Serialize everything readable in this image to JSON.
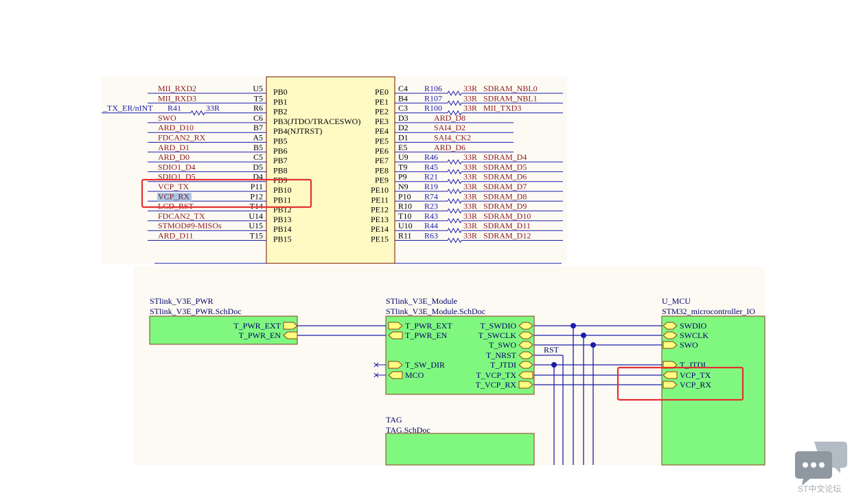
{
  "top_schematic": {
    "chip_left_pins": [
      {
        "net": "MII_RXD2",
        "ball": "U5",
        "pin": "PB0",
        "resistor": "",
        "value": ""
      },
      {
        "net": "MII_RXD3",
        "ball": "T5",
        "pin": "PB1",
        "resistor": "",
        "value": ""
      },
      {
        "net": "_TX_ER/nINT",
        "ball": "R6",
        "pin": "PB2",
        "resistor": "R41",
        "value": "33R"
      },
      {
        "net": "SWO",
        "ball": "C6",
        "pin": "PB3(JTDO/TRACESWO)",
        "resistor": "",
        "value": ""
      },
      {
        "net": "ARD_D10",
        "ball": "B7",
        "pin": "PB4(NJTRST)",
        "resistor": "",
        "value": ""
      },
      {
        "net": "FDCAN2_RX",
        "ball": "A5",
        "pin": "PB5",
        "resistor": "",
        "value": ""
      },
      {
        "net": "ARD_D1",
        "ball": "B5",
        "pin": "PB6",
        "resistor": "",
        "value": ""
      },
      {
        "net": "ARD_D0",
        "ball": "C5",
        "pin": "PB7",
        "resistor": "",
        "value": ""
      },
      {
        "net": "SDIO1_D4",
        "ball": "D5",
        "pin": "PB8",
        "resistor": "",
        "value": ""
      },
      {
        "net": "SDIO1_D5",
        "ball": "D4",
        "pin": "PB9",
        "resistor": "",
        "value": ""
      },
      {
        "net": "VCP_TX",
        "ball": "P11",
        "pin": "PB10",
        "resistor": "",
        "value": ""
      },
      {
        "net": "VCP_RX",
        "ball": "P12",
        "pin": "PB11",
        "resistor": "",
        "value": ""
      },
      {
        "net": "LCD_RST",
        "ball": "T14",
        "pin": "PB12",
        "resistor": "",
        "value": ""
      },
      {
        "net": "FDCAN2_TX",
        "ball": "U14",
        "pin": "PB13",
        "resistor": "",
        "value": ""
      },
      {
        "net": "STMOD#9-MISOs",
        "ball": "U15",
        "pin": "PB14",
        "resistor": "",
        "value": ""
      },
      {
        "net": "ARD_D11",
        "ball": "T15",
        "pin": "PB15",
        "resistor": "",
        "value": ""
      }
    ],
    "chip_right_pins": [
      {
        "pin": "PE0",
        "ball": "C4",
        "resistor": "R106",
        "value": "33R",
        "net": "SDRAM_NBL0"
      },
      {
        "pin": "PE1",
        "ball": "B4",
        "resistor": "R107",
        "value": "33R",
        "net": "SDRAM_NBL1"
      },
      {
        "pin": "PE2",
        "ball": "C3",
        "resistor": "R100",
        "value": "33R",
        "net": "MII_TXD3"
      },
      {
        "pin": "PE3",
        "ball": "D3",
        "resistor": "",
        "value": "",
        "net": "ARD_D8"
      },
      {
        "pin": "PE4",
        "ball": "D2",
        "resistor": "",
        "value": "",
        "net": "SAI4_D2"
      },
      {
        "pin": "PE5",
        "ball": "D1",
        "resistor": "",
        "value": "",
        "net": "SAI4_CK2"
      },
      {
        "pin": "PE6",
        "ball": "E5",
        "resistor": "",
        "value": "",
        "net": "ARD_D6"
      },
      {
        "pin": "PE7",
        "ball": "U9",
        "resistor": "R46",
        "value": "33R",
        "net": "SDRAM_D4"
      },
      {
        "pin": "PE8",
        "ball": "T9",
        "resistor": "R45",
        "value": "33R",
        "net": "SDRAM_D5"
      },
      {
        "pin": "PE9",
        "ball": "P9",
        "resistor": "R21",
        "value": "33R",
        "net": "SDRAM_D6"
      },
      {
        "pin": "PE10",
        "ball": "N9",
        "resistor": "R19",
        "value": "33R",
        "net": "SDRAM_D7"
      },
      {
        "pin": "PE11",
        "ball": "P10",
        "resistor": "R74",
        "value": "33R",
        "net": "SDRAM_D8"
      },
      {
        "pin": "PE12",
        "ball": "R10",
        "resistor": "R23",
        "value": "33R",
        "net": "SDRAM_D9"
      },
      {
        "pin": "PE13",
        "ball": "T10",
        "resistor": "R43",
        "value": "33R",
        "net": "SDRAM_D10"
      },
      {
        "pin": "PE14",
        "ball": "U10",
        "resistor": "R44",
        "value": "33R",
        "net": "SDRAM_D11"
      },
      {
        "pin": "PE15",
        "ball": "R11",
        "resistor": "R63",
        "value": "33R",
        "net": "SDRAM_D12"
      }
    ]
  },
  "bottom_schematic": {
    "pwr_sheet": {
      "name": "STlink_V3E_PWR",
      "file": "STlink_V3E_PWR.SchDoc",
      "ports": [
        "T_PWR_EXT",
        "T_PWR_EN"
      ]
    },
    "module_sheet": {
      "name": "STlink_V3E_Module",
      "file": "STlink_V3E_Module.SchDoc",
      "left_ports": [
        "T_PWR_EXT",
        "T_PWR_EN",
        "T_SW_DIR",
        "MCO"
      ],
      "right_ports": [
        "T_SWDIO",
        "T_SWCLK",
        "T_SWO",
        "T_NRST",
        "T_JTDI",
        "T_VCP_TX",
        "T_VCP_RX"
      ]
    },
    "net_label_rst": "RST",
    "tag_sheet": {
      "name": "TAG",
      "file": "TAG.SchDoc"
    },
    "mcu_sheet": {
      "name": "U_MCU",
      "file": "STM32_microcontroller_IO",
      "ports": [
        "SWDIO",
        "SWCLK",
        "SWO",
        "T_JTDI",
        "VCP_TX",
        "VCP_RX"
      ]
    }
  },
  "watermark": {
    "text": "ST中文论坛"
  },
  "colors": {
    "wire": "#1c1ca8",
    "net_text": "#8b1a1a",
    "pin_text": "#000000",
    "chip_fill": "#fff9c4",
    "sheet_fill": "#80f880",
    "port_fill": "#ffff80",
    "highlight": "#e53030",
    "selection": "#a9c6e6",
    "canvas_bg": "#fdfaf4"
  }
}
